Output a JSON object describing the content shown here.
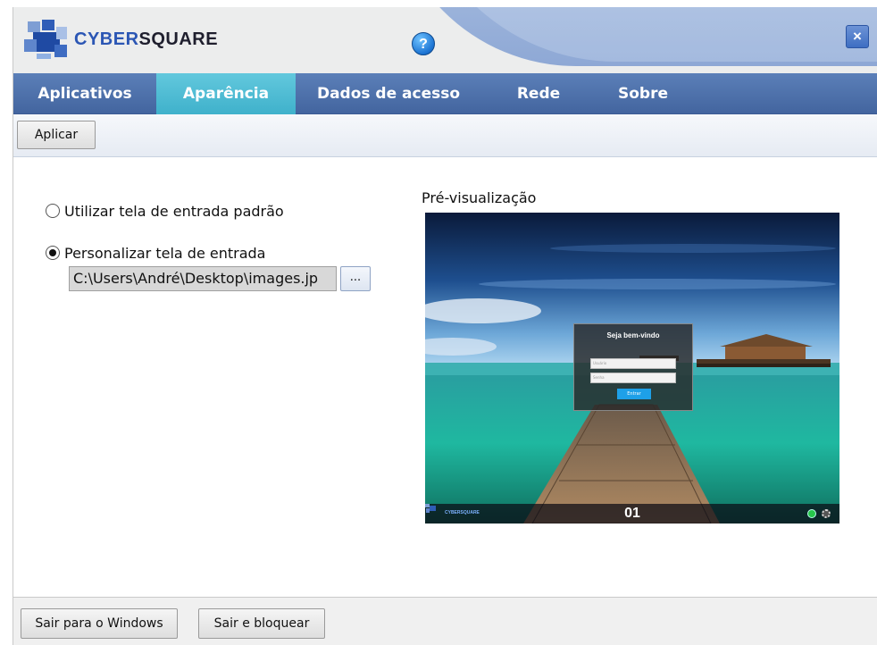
{
  "app": {
    "brand_part1": "CYBER",
    "brand_part2": "SQUARE",
    "help_symbol": "?",
    "close_symbol": "×"
  },
  "tabs": [
    {
      "label": "Aplicativos",
      "active": false
    },
    {
      "label": "Aparência",
      "active": true
    },
    {
      "label": "Dados de acesso",
      "active": false
    },
    {
      "label": "Rede",
      "active": false
    },
    {
      "label": "Sobre",
      "active": false
    }
  ],
  "toolbar": {
    "apply_label": "Aplicar"
  },
  "options": {
    "default_label": "Utilizar tela de entrada padrão",
    "default_selected": false,
    "custom_label": "Personalizar tela de entrada",
    "custom_selected": true,
    "path_value": "C:\\Users\\André\\Desktop\\images.jp",
    "browse_label": "..."
  },
  "preview": {
    "label": "Pré-visualização",
    "login_title": "Seja bem-vindo",
    "user_placeholder": "Usuário",
    "password_placeholder": "Senha",
    "login_button": "Entrar",
    "mini_brand": "CYBERSQUARE",
    "station_number": "01"
  },
  "footer": {
    "exit_windows_label": "Sair para o Windows",
    "exit_lock_label": "Sair e bloquear"
  },
  "colors": {
    "tab_bar": "#4d71ad",
    "tab_active": "#4fbcd3",
    "brand_blue": "#2b56b4"
  }
}
